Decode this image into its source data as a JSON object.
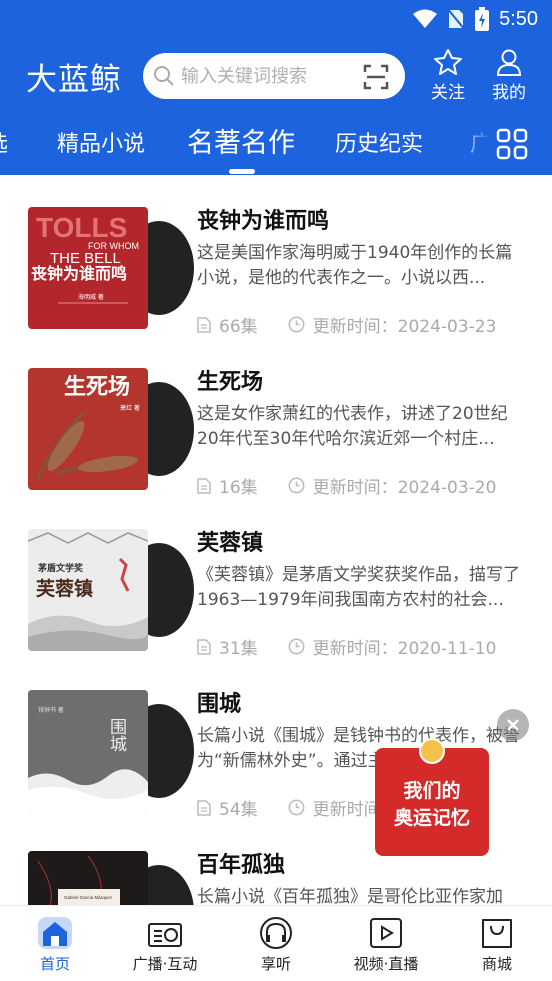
{
  "status": {
    "time": "5:50"
  },
  "app": {
    "title": "大蓝鲸"
  },
  "search": {
    "placeholder": "输入关键词搜索"
  },
  "top_actions": {
    "follow": "关注",
    "mine": "我的"
  },
  "tabs": [
    "选",
    "精品小说",
    "名著名作",
    "历史纪实",
    "广"
  ],
  "active_tab_index": 2,
  "books": [
    {
      "title": "丧钟为谁而鸣",
      "desc": "这是美国作家海明威于1940年创作的长篇小说，是他的代表作之一。小说以西...",
      "episodes": "66集",
      "updated": "更新时间：2024-03-23",
      "cover": {
        "line1": "TOLLS",
        "line2": "FOR WHOM",
        "line3": "THE BELL",
        "line4": "丧钟为谁而鸣",
        "author": "海明威 著"
      }
    },
    {
      "title": "生死场",
      "desc": "这是女作家萧红的代表作，讲述了20世纪20年代至30年代哈尔滨近郊一个村庄...",
      "episodes": "16集",
      "updated": "更新时间：2024-03-20",
      "cover": {
        "line1": "生死场",
        "author": "萧红 著"
      }
    },
    {
      "title": "芙蓉镇",
      "desc": "《芙蓉镇》是茅盾文学奖获奖作品，描写了1963—1979年间我国南方农村的社会...",
      "episodes": "31集",
      "updated": "更新时间：2020-11-10",
      "cover": {
        "line1": "茅盾文学奖",
        "line2": "芙蓉镇"
      }
    },
    {
      "title": "围城",
      "desc": "长篇小说《围城》是钱钟书的代表作，被誉为“新儒林外史”。通过主人公方鸿渐...",
      "episodes": "54集",
      "updated": "更新时间：",
      "cover": {
        "line1": "围城",
        "author": "钱钟书 著"
      }
    },
    {
      "title": "百年孤独",
      "desc": "长篇小说《百年孤独》是哥伦比亚作家加",
      "episodes": "",
      "updated": "",
      "cover": {
        "line1": "Gabriel García Márquez"
      }
    }
  ],
  "ad": {
    "line1": "我们的",
    "line2": "奥运记忆"
  },
  "bottom_nav": [
    "首页",
    "广播·互动",
    "享听",
    "视频·直播",
    "商城"
  ],
  "colors": {
    "brand": "#1d63de"
  }
}
